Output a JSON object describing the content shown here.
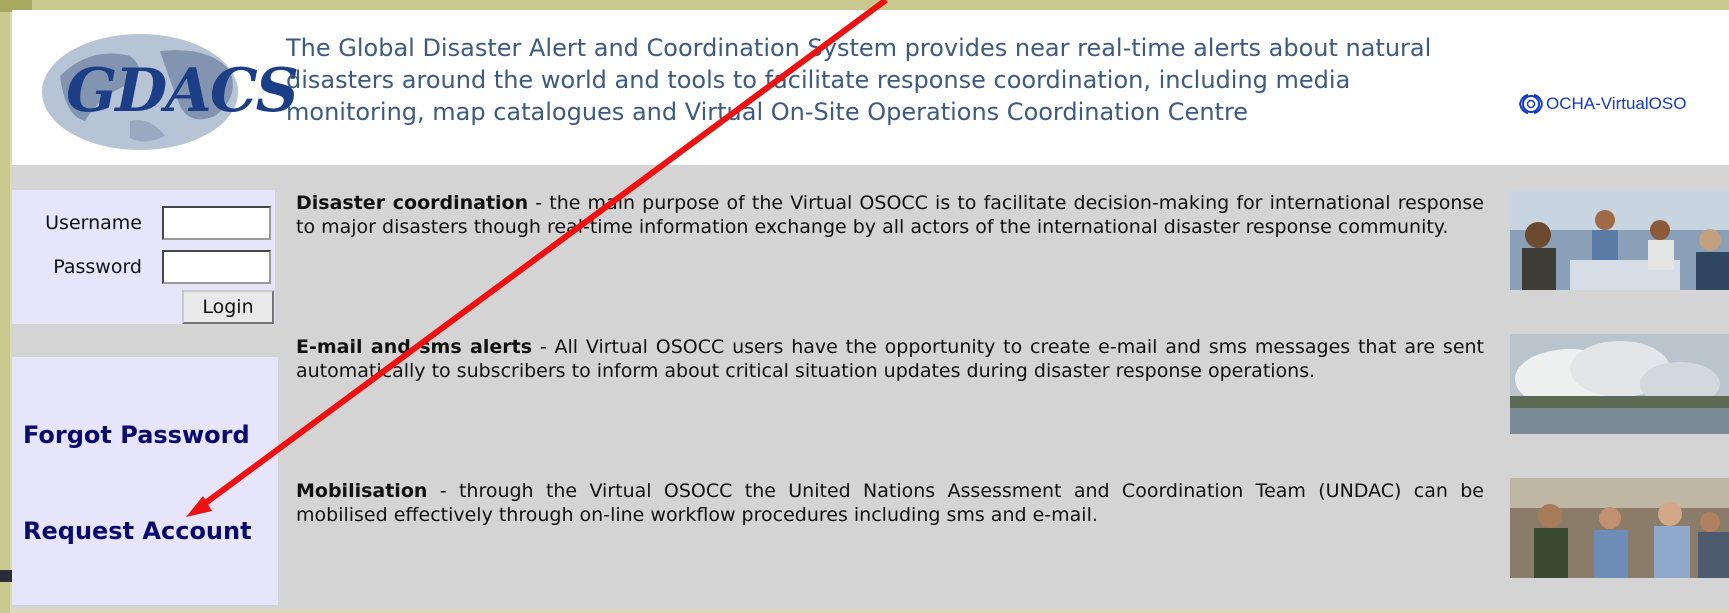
{
  "header": {
    "logo_text": "GDACS",
    "description": "The Global Disaster Alert and Coordination System provides near real-time alerts about natural disasters around the world and tools to facilitate response coordination, including media monitoring, map catalogues and Virtual On-Site Operations Coordination Centre",
    "partner_logo_text": "OCHA-VirtualOSO"
  },
  "login": {
    "username_label": "Username",
    "username_value": "",
    "password_label": "Password",
    "password_value": "",
    "login_button": "Login"
  },
  "links": {
    "forgot_password": "Forgot Password",
    "request_account": "Request Account"
  },
  "sections": [
    {
      "title": "Disaster coordination",
      "body": " - the main purpose of the Virtual OSOCC is to facilitate decision-making for international response to major disasters though real-time information exchange by all actors of the international disaster response community."
    },
    {
      "title": "E-mail and sms alerts",
      "body": " - All Virtual OSOCC users have the opportunity to create e-mail and sms messages that are sent automatically to subscribers to inform about critical situation updates during disaster response operations."
    },
    {
      "title": "Mobilisation",
      "body": " - through the Virtual OSOCC the United Nations Assessment and Coordination Team (UNDAC) can be mobilised effectively through on-line workflow procedures including sms and e-mail."
    }
  ],
  "annotation": {
    "arrow_color": "#ee1111"
  },
  "colors": {
    "page_background": "#d4d4d4",
    "panel_background": "#e7e5fb",
    "link_color": "#0a0a6e",
    "header_text": "#3d5a80"
  }
}
